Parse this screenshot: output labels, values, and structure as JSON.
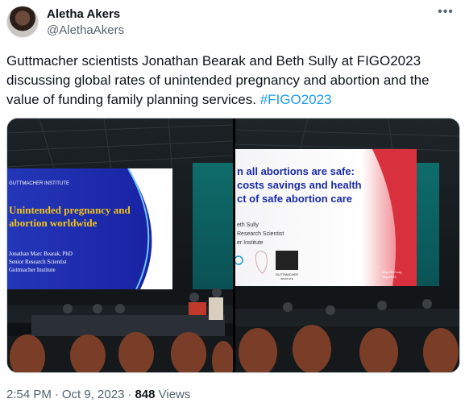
{
  "author": {
    "display_name": "Aletha Akers",
    "handle": "@AlethaAkers"
  },
  "more_icon": "more-horizontal-icon",
  "tweet": {
    "text": "Guttmacher scientists Jonathan Bearak and Beth Sully at FIGO2023 discussing global rates of unintended pregnancy and abortion and the value of funding family planning services.",
    "hashtag": "#FIGO2023"
  },
  "photos": {
    "left": {
      "slide_header": "GUTTMACHER INSTITUTE",
      "slide_title_1": "Unintended pregnancy and",
      "slide_title_2": "abortion worldwide",
      "presenter": "Jonathan Marc Bearak, PhD",
      "role": "Senior Research Scientist",
      "org": "Guttmacher Institute"
    },
    "right": {
      "slide_title_1": "n all abortions are safe:",
      "slide_title_2": "costs savings and health",
      "slide_title_3": "ct of safe abortion care",
      "presenter": "eth Sully",
      "role": "Research Scientist",
      "org": "er Institute",
      "logo_text": "GUTTMACHER",
      "logo_sub": "INSTITUTE",
      "hashtag_1": "#figo2023.org",
      "hashtag_2": "#figo2023"
    }
  },
  "meta": {
    "time": "2:54 PM",
    "date": "Oct 9, 2023",
    "views_count": "848",
    "views_label": "Views"
  },
  "colors": {
    "hashtag_blue": "#1d9bf0",
    "secondary_text": "#536471",
    "slide_blue": "#1a2ca8",
    "slide_red": "#c8202f"
  }
}
